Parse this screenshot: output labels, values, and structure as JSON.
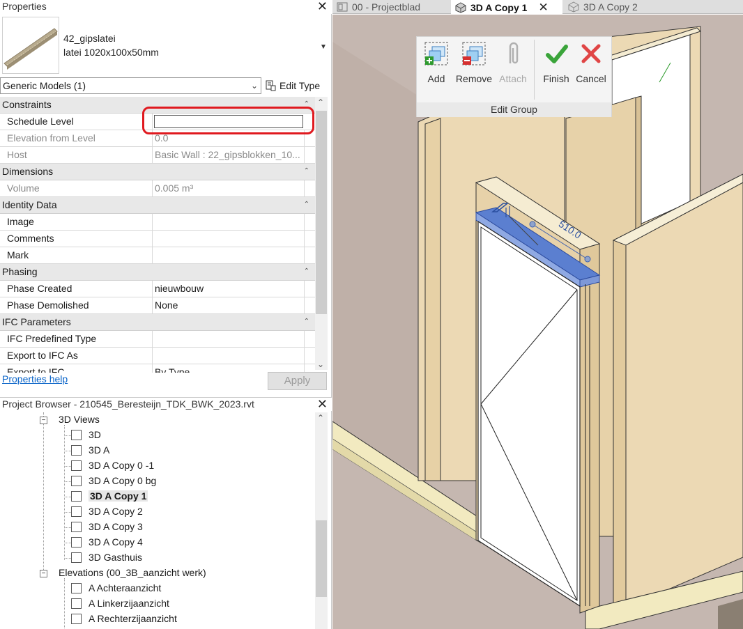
{
  "properties_panel": {
    "title": "Properties",
    "type_name": "42_gipslatei",
    "type_size": "latei 1020x100x50mm",
    "category_filter": "Generic Models (1)",
    "edit_type_label": "Edit Type",
    "groups": [
      {
        "name": "Constraints",
        "rows": [
          {
            "name": "Schedule Level",
            "value": "",
            "disabled": false
          },
          {
            "name": "Elevation from Level",
            "value": "0.0",
            "disabled": true
          },
          {
            "name": "Host",
            "value": "Basic Wall : 22_gipsblokken_10...",
            "disabled": true
          }
        ]
      },
      {
        "name": "Dimensions",
        "rows": [
          {
            "name": "Volume",
            "value": "0.005 m³",
            "disabled": true
          }
        ]
      },
      {
        "name": "Identity Data",
        "rows": [
          {
            "name": "Image",
            "value": "",
            "disabled": false
          },
          {
            "name": "Comments",
            "value": "",
            "disabled": false
          },
          {
            "name": "Mark",
            "value": "",
            "disabled": false
          }
        ]
      },
      {
        "name": "Phasing",
        "rows": [
          {
            "name": "Phase Created",
            "value": "nieuwbouw",
            "disabled": false
          },
          {
            "name": "Phase Demolished",
            "value": "None",
            "disabled": false
          }
        ]
      },
      {
        "name": "IFC Parameters",
        "rows": [
          {
            "name": "IFC Predefined Type",
            "value": "",
            "disabled": false
          },
          {
            "name": "Export to IFC As",
            "value": "",
            "disabled": false
          },
          {
            "name": "Export to IFC",
            "value": "By Type",
            "disabled": false
          }
        ]
      }
    ],
    "help_link": "Properties help",
    "apply_label": "Apply"
  },
  "project_browser": {
    "title": "Project Browser - 210545_Beresteijn_TDK_BWK_2023.rvt",
    "views_group": "3D Views",
    "views": [
      "3D",
      "3D A",
      "3D A Copy 0 -1",
      "3D A Copy 0 bg",
      "3D A Copy 1",
      "3D A Copy 2",
      "3D A Copy 3",
      "3D A Copy 4",
      "3D Gasthuis"
    ],
    "selected_view": "3D A Copy 1",
    "elevations_group": "Elevations (00_3B_aanzicht werk)",
    "elevations": [
      "A Achteraanzicht",
      "A Linkerzijaanzicht",
      "A Rechterzijaanzicht"
    ]
  },
  "view_tabs": [
    {
      "label": "00 - Projectblad",
      "active": false
    },
    {
      "label": "3D A Copy 1",
      "active": true
    },
    {
      "label": "3D A Copy 2",
      "active": false
    }
  ],
  "edit_group": {
    "title": "Edit Group",
    "add": "Add",
    "remove": "Remove",
    "attach": "Attach",
    "finish": "Finish",
    "cancel": "Cancel"
  },
  "model_view": {
    "dimension_label": "510.0"
  }
}
